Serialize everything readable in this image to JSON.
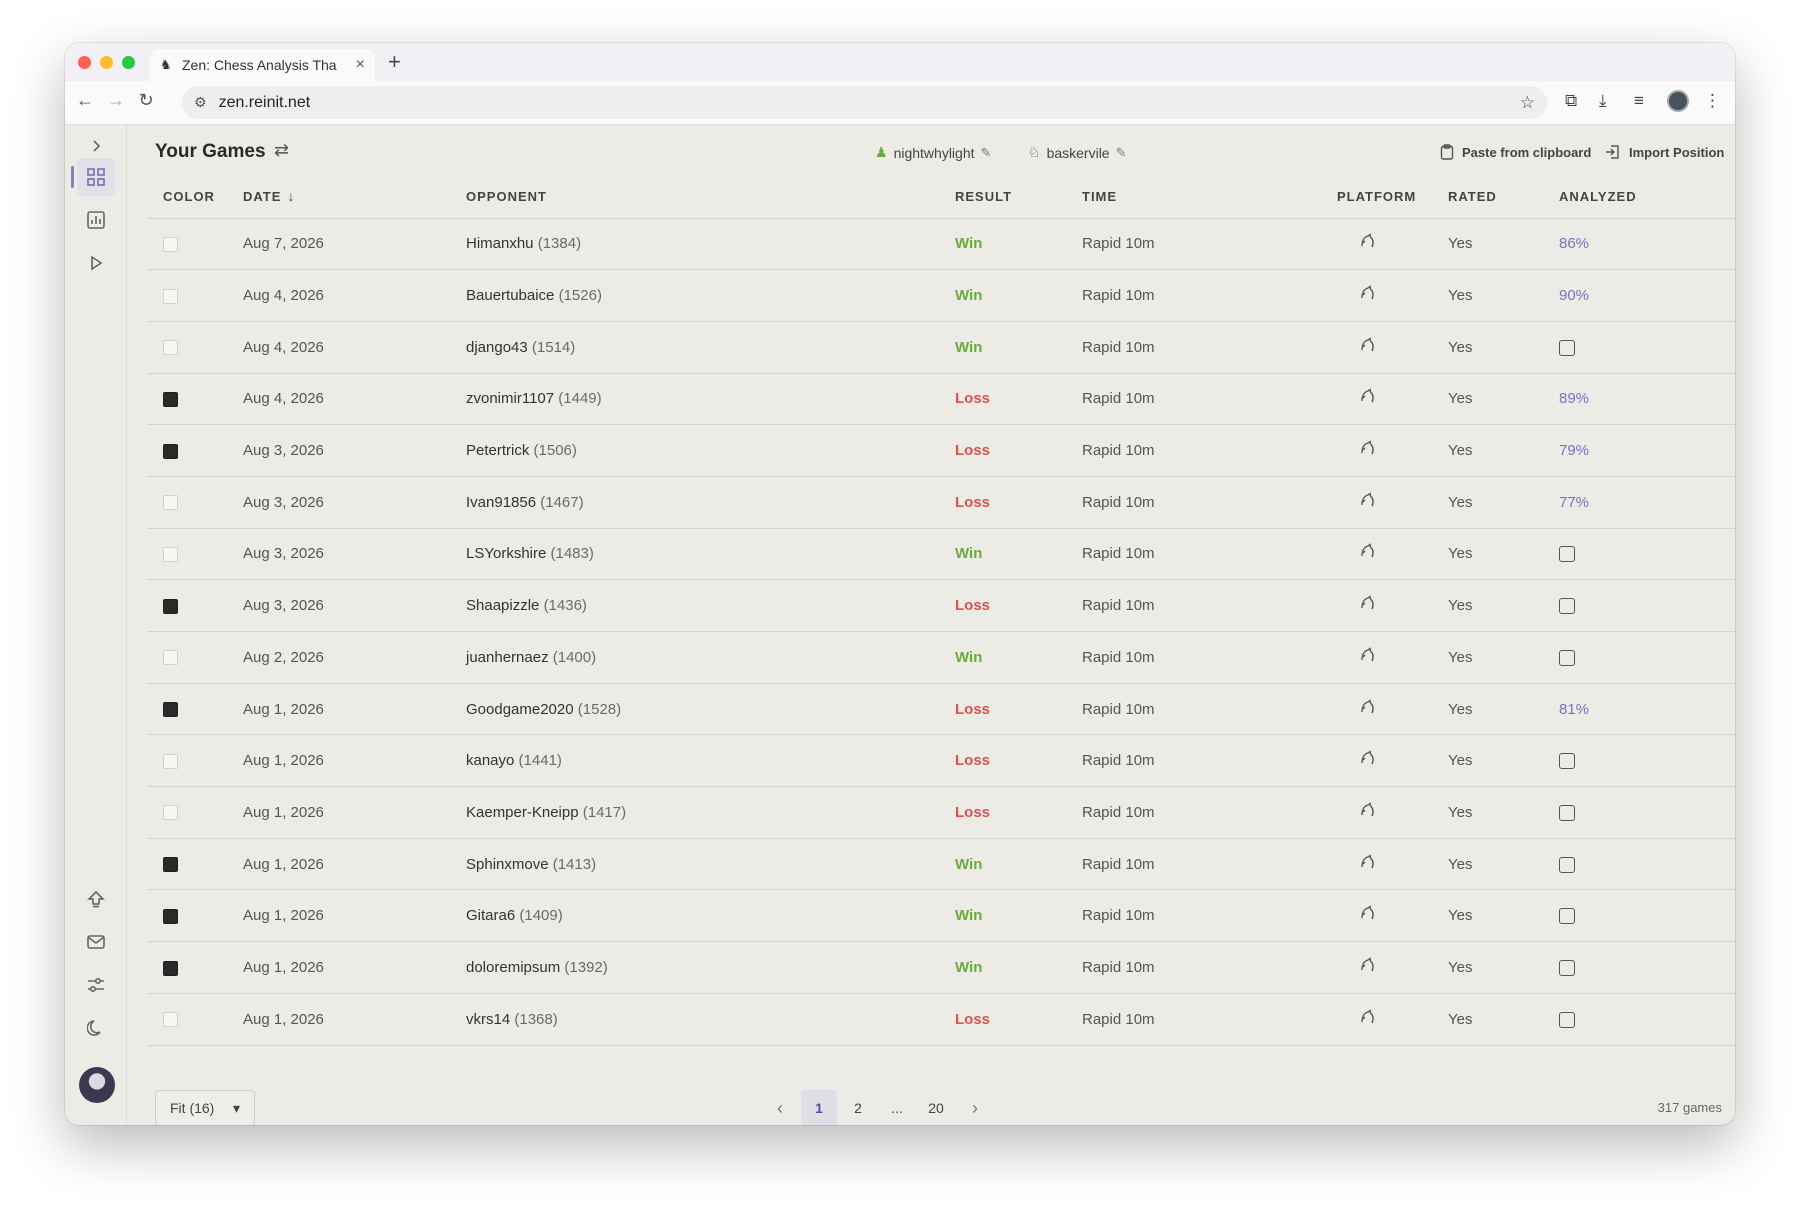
{
  "browser": {
    "tab_title": "Zen: Chess Analysis Tha",
    "tab_favicon": "knight-icon",
    "url": "zen.reinit.net"
  },
  "header": {
    "title": "Your Games",
    "accounts": [
      {
        "name": "nightwhylight",
        "icon": "pawn-icon"
      },
      {
        "name": "baskervile",
        "icon": "lichess-icon"
      }
    ],
    "paste_label": "Paste from clipboard",
    "import_label": "Import Position"
  },
  "table": {
    "columns": [
      "COLOR",
      "DATE",
      "OPPONENT",
      "RESULT",
      "TIME",
      "PLATFORM",
      "RATED",
      "ANALYZED"
    ],
    "sort_indicator": "↓",
    "rows": [
      {
        "color": "white",
        "date": "Aug 7, 2026",
        "opponent": "Himanxhu",
        "rating": "(1384)",
        "result": "Win",
        "time": "Rapid 10m",
        "rated": "Yes",
        "analyzed": "86%"
      },
      {
        "color": "white",
        "date": "Aug 4, 2026",
        "opponent": "Bauertubaice",
        "rating": "(1526)",
        "result": "Win",
        "time": "Rapid 10m",
        "rated": "Yes",
        "analyzed": "90%"
      },
      {
        "color": "white",
        "date": "Aug 4, 2026",
        "opponent": "django43",
        "rating": "(1514)",
        "result": "Win",
        "time": "Rapid 10m",
        "rated": "Yes",
        "analyzed": ""
      },
      {
        "color": "black",
        "date": "Aug 4, 2026",
        "opponent": "zvonimir1107",
        "rating": "(1449)",
        "result": "Loss",
        "time": "Rapid 10m",
        "rated": "Yes",
        "analyzed": "89%"
      },
      {
        "color": "black",
        "date": "Aug 3, 2026",
        "opponent": "Petertrick",
        "rating": "(1506)",
        "result": "Loss",
        "time": "Rapid 10m",
        "rated": "Yes",
        "analyzed": "79%"
      },
      {
        "color": "white",
        "date": "Aug 3, 2026",
        "opponent": "Ivan91856",
        "rating": "(1467)",
        "result": "Loss",
        "time": "Rapid 10m",
        "rated": "Yes",
        "analyzed": "77%"
      },
      {
        "color": "white",
        "date": "Aug 3, 2026",
        "opponent": "LSYorkshire",
        "rating": "(1483)",
        "result": "Win",
        "time": "Rapid 10m",
        "rated": "Yes",
        "analyzed": ""
      },
      {
        "color": "black",
        "date": "Aug 3, 2026",
        "opponent": "Shaapizzle",
        "rating": "(1436)",
        "result": "Loss",
        "time": "Rapid 10m",
        "rated": "Yes",
        "analyzed": ""
      },
      {
        "color": "white",
        "date": "Aug 2, 2026",
        "opponent": "juanhernaez",
        "rating": "(1400)",
        "result": "Win",
        "time": "Rapid 10m",
        "rated": "Yes",
        "analyzed": ""
      },
      {
        "color": "black",
        "date": "Aug 1, 2026",
        "opponent": "Goodgame2020",
        "rating": "(1528)",
        "result": "Loss",
        "time": "Rapid 10m",
        "rated": "Yes",
        "analyzed": "81%"
      },
      {
        "color": "white",
        "date": "Aug 1, 2026",
        "opponent": "kanayo",
        "rating": "(1441)",
        "result": "Loss",
        "time": "Rapid 10m",
        "rated": "Yes",
        "analyzed": ""
      },
      {
        "color": "white",
        "date": "Aug 1, 2026",
        "opponent": "Kaemper-Kneipp",
        "rating": "(1417)",
        "result": "Loss",
        "time": "Rapid 10m",
        "rated": "Yes",
        "analyzed": ""
      },
      {
        "color": "black",
        "date": "Aug 1, 2026",
        "opponent": "Sphinxmove",
        "rating": "(1413)",
        "result": "Win",
        "time": "Rapid 10m",
        "rated": "Yes",
        "analyzed": ""
      },
      {
        "color": "black",
        "date": "Aug 1, 2026",
        "opponent": "Gitara6",
        "rating": "(1409)",
        "result": "Win",
        "time": "Rapid 10m",
        "rated": "Yes",
        "analyzed": ""
      },
      {
        "color": "black",
        "date": "Aug 1, 2026",
        "opponent": "doloremipsum",
        "rating": "(1392)",
        "result": "Win",
        "time": "Rapid 10m",
        "rated": "Yes",
        "analyzed": ""
      },
      {
        "color": "white",
        "date": "Aug 1, 2026",
        "opponent": "vkrs14",
        "rating": "(1368)",
        "result": "Loss",
        "time": "Rapid 10m",
        "rated": "Yes",
        "analyzed": ""
      }
    ]
  },
  "footer": {
    "fit_label": "Fit (16)",
    "pages": [
      "1",
      "2",
      "...",
      "20"
    ],
    "current_page": "1",
    "total": "317 games"
  },
  "colors": {
    "win": "#6bab3a",
    "loss": "#d9534f",
    "accent": "#7f6fc4"
  }
}
